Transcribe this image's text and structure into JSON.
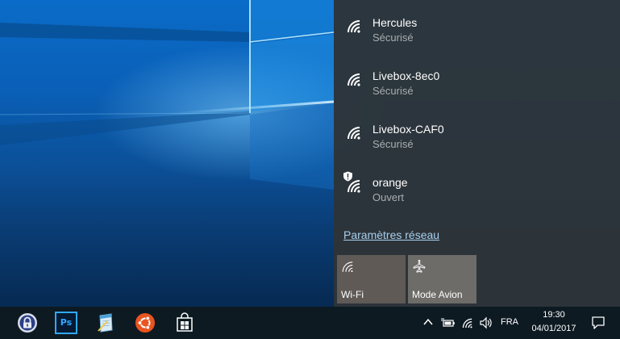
{
  "networks": [
    {
      "ssid": "Hercules",
      "status": "Sécurisé",
      "icon": "wifi-icon",
      "warning": false
    },
    {
      "ssid": "Livebox-8ec0",
      "status": "Sécurisé",
      "icon": "wifi-icon",
      "warning": false
    },
    {
      "ssid": "Livebox-CAF0",
      "status": "Sécurisé",
      "icon": "wifi-icon",
      "warning": false
    },
    {
      "ssid": "orange",
      "status": "Ouvert",
      "icon": "wifi-icon",
      "warning": true
    }
  ],
  "flyout": {
    "settings_link": "Paramètres réseau",
    "quick_actions": [
      {
        "label": "Wi-Fi",
        "icon": "wifi-icon"
      },
      {
        "label": "Mode Avion",
        "icon": "airplane-icon"
      }
    ]
  },
  "taskbar": {
    "apps": [
      "keepass-icon",
      "photoshop-icon",
      "notepad-icon",
      "ubuntu-icon",
      "store-icon"
    ],
    "photoshop_label": "Ps",
    "language": "FRA",
    "time": "19:30",
    "date": "04/01/2017"
  },
  "colors": {
    "flyout_bg": "#2e3438",
    "link": "#a8cfee",
    "quick_action_bg": "#5f5a56",
    "secondary_text": "#a9aeb1",
    "taskbar_bg": "#0d1a22"
  }
}
